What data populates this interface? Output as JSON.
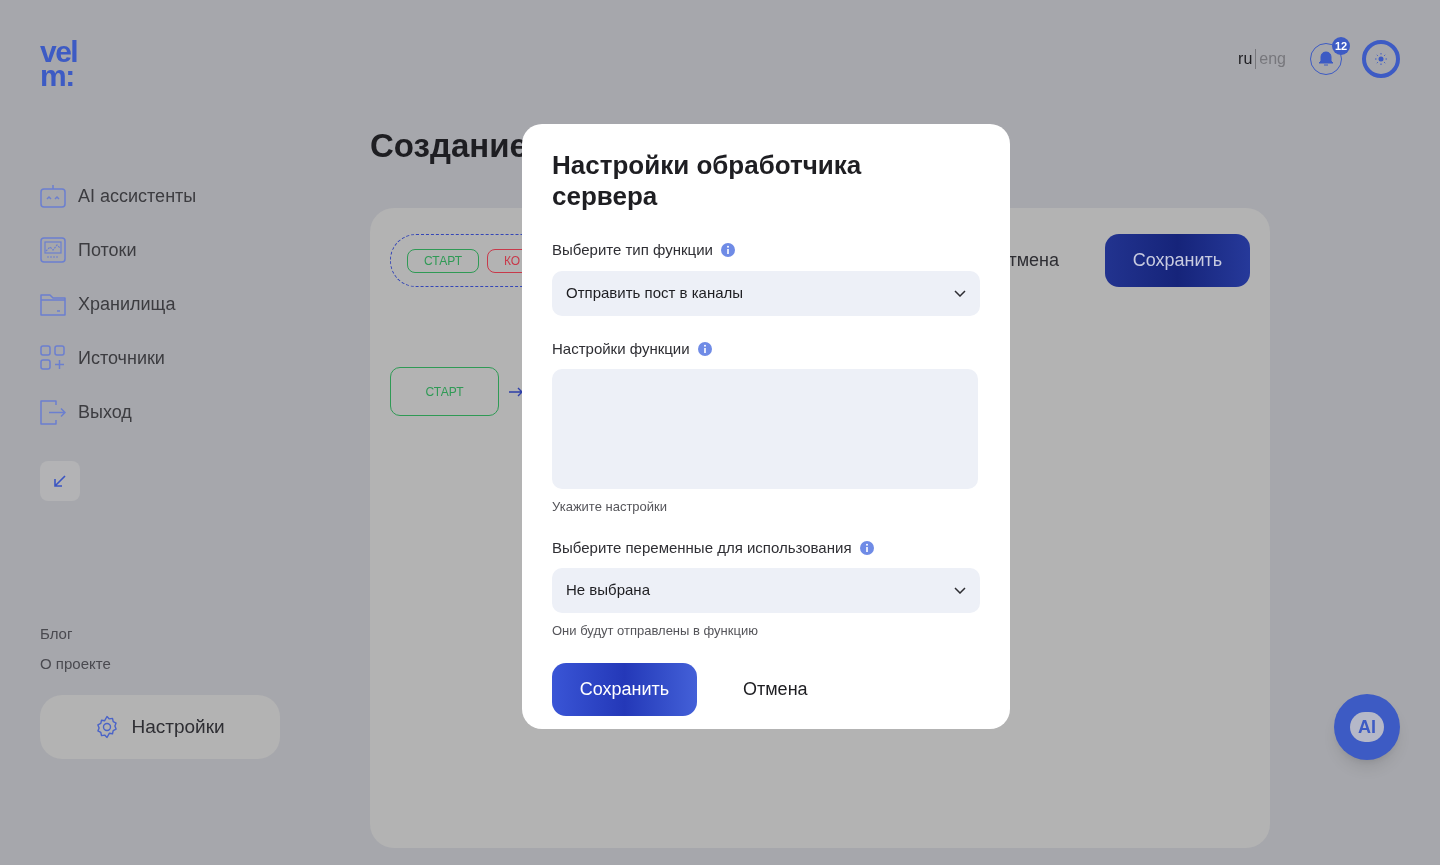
{
  "logo": {
    "line_1": "vel",
    "line_2": "m:"
  },
  "languages": [
    {
      "label": "ru",
      "selected": true
    },
    {
      "label": "eng",
      "selected": false
    }
  ],
  "notifications": {
    "count": "12"
  },
  "sidebar": {
    "items": [
      {
        "label": "AI ассистенты"
      },
      {
        "label": "Потоки"
      },
      {
        "label": "Хранилища"
      },
      {
        "label": "Источники"
      },
      {
        "label": "Выход"
      }
    ],
    "links": [
      "Блог",
      "О проекте"
    ],
    "settings_button": "Настройки"
  },
  "page": {
    "title": "Создание",
    "toolbar": {
      "cancel": "тмена",
      "save": "Сохранить"
    },
    "palette": [
      {
        "label": "СТАРТ",
        "color": "#2f9a55"
      },
      {
        "label": "КО",
        "color": "#c8394a"
      }
    ],
    "nodes": [
      {
        "label": "СТАРТ",
        "color": "#2f9a55"
      }
    ]
  },
  "modal": {
    "title": "Настройки обработчика сервера",
    "fields": [
      {
        "kind": "select",
        "label": "Выберите тип функции",
        "value": "Отправить пост в каналы"
      },
      {
        "kind": "textarea",
        "label": "Настройки функции",
        "hint": "Укажите настройки"
      },
      {
        "kind": "select",
        "label": "Выберите переменные для использования",
        "value": "Не выбрана",
        "hint": "Они будут отправлены в функцию"
      }
    ],
    "save": "Сохранить",
    "cancel": "Отмена"
  },
  "assistant_button": {
    "label": "AI"
  }
}
